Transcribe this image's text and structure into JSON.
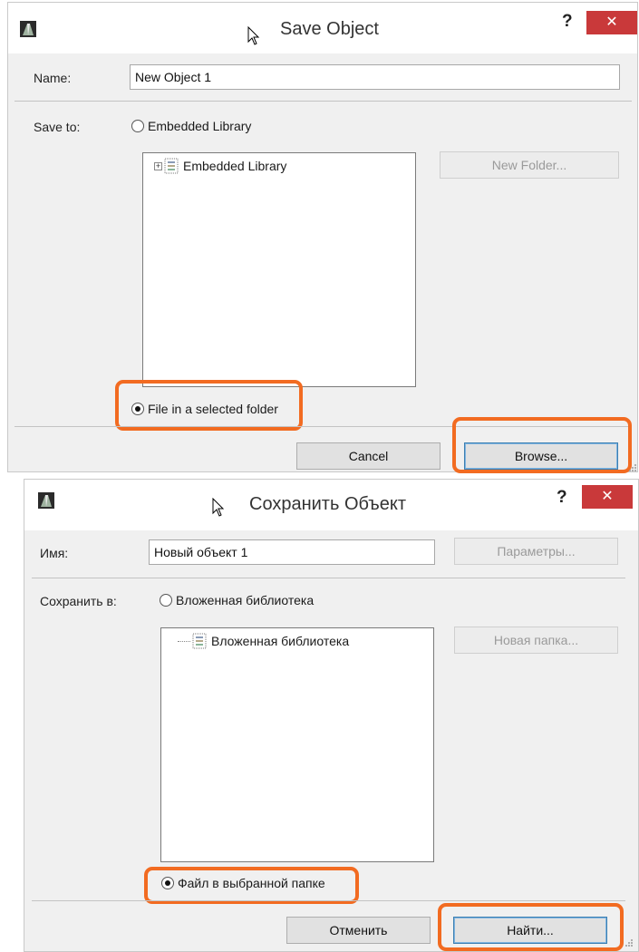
{
  "dialog_en": {
    "title": "Save Object",
    "help": "?",
    "close": "✕",
    "name_label": "Name:",
    "name_value": "New Object 1",
    "save_to_label": "Save to:",
    "radio_embedded": "Embedded Library",
    "tree_root": "Embedded Library",
    "new_folder_button": "New Folder...",
    "radio_file": "File in a selected folder",
    "cancel_button": "Cancel",
    "browse_button": "Browse..."
  },
  "dialog_ru": {
    "title": "Сохранить Объект",
    "help": "?",
    "close": "✕",
    "name_label": "Имя:",
    "name_value": "Новый объект 1",
    "params_button": "Параметры...",
    "save_to_label": "Сохранить в:",
    "radio_embedded": "Вложенная библиотека",
    "tree_root": "Вложенная библиотека",
    "new_folder_button": "Новая папка...",
    "radio_file": "Файл в выбранной папке",
    "cancel_button": "Отменить",
    "browse_button": "Найти..."
  },
  "colors": {
    "highlight": "#f26b21",
    "close_button": "#c9393a",
    "dialog_bg": "#f0f0f0"
  },
  "icons": [
    "archicad-app-icon",
    "mouse-cursor-icon",
    "library-folder-icon",
    "tree-expand-icon"
  ]
}
